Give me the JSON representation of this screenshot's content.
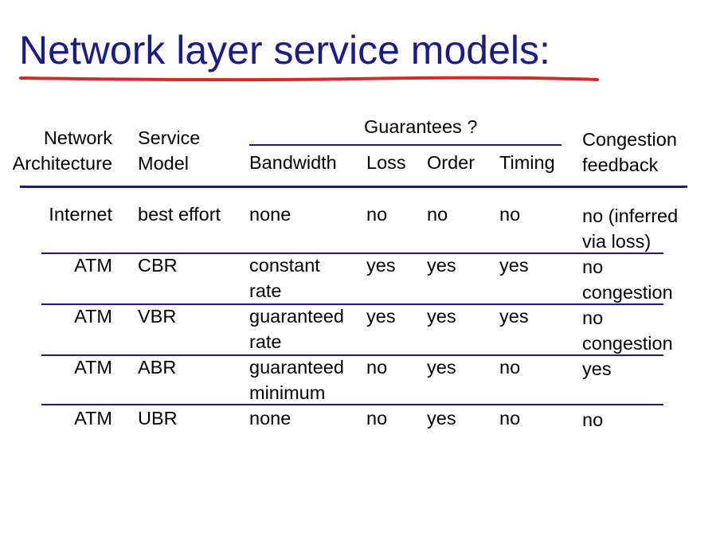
{
  "title": "Network layer service models:",
  "colors": {
    "title": "#1a1a8c",
    "underline": "#d42a2a",
    "rule": "#1a1a8c"
  },
  "header": {
    "network": "Network",
    "architecture": "Architecture",
    "service": "Service",
    "model": "Model",
    "guarantees": "Guarantees ?",
    "bandwidth": "Bandwidth",
    "loss": "Loss",
    "order": "Order",
    "timing": "Timing",
    "congestion": "Congestion",
    "feedback": "feedback"
  },
  "rows": [
    {
      "arch": "Internet",
      "model": "best effort",
      "bw1": "none",
      "bw2": "",
      "loss": "no",
      "order": "no",
      "timing": "no",
      "fb1": "no (inferred",
      "fb2": "via loss)"
    },
    {
      "arch": "ATM",
      "model": "CBR",
      "bw1": "constant",
      "bw2": "rate",
      "loss": "yes",
      "order": "yes",
      "timing": "yes",
      "fb1": "no",
      "fb2": "congestion"
    },
    {
      "arch": "ATM",
      "model": "VBR",
      "bw1": "guaranteed",
      "bw2": "rate",
      "loss": "yes",
      "order": "yes",
      "timing": "yes",
      "fb1": "no",
      "fb2": "congestion"
    },
    {
      "arch": "ATM",
      "model": "ABR",
      "bw1": "guaranteed",
      "bw2": "minimum",
      "loss": "no",
      "order": "yes",
      "timing": "no",
      "fb1": "yes",
      "fb2": ""
    },
    {
      "arch": "ATM",
      "model": "UBR",
      "bw1": "none",
      "bw2": "",
      "loss": "no",
      "order": "yes",
      "timing": "no",
      "fb1": "no",
      "fb2": ""
    }
  ]
}
